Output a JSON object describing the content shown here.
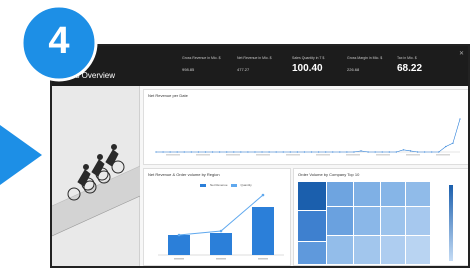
{
  "step_number": "4",
  "header": {
    "title": "Orders Overview",
    "kpis": [
      {
        "label": "Gross Revenue in Mio. $",
        "value": "998.85",
        "big": false
      },
      {
        "label": "Net Revenue in Mio. $",
        "value": "477.27",
        "big": false
      },
      {
        "label": "Sales Quantity in T $",
        "value": "100.40",
        "big": true
      },
      {
        "label": "Gross Margin in Mio. $",
        "value": "226.68",
        "big": false
      },
      {
        "label": "Tax in Mio. $",
        "value": "68.22",
        "big": true
      }
    ]
  },
  "revenue_card": {
    "title": "Net Revenue per Date"
  },
  "bar_card": {
    "title": "Net Revenue & Order volume by Region",
    "legend": [
      "Net Revenue",
      "Quantity"
    ]
  },
  "map_card": {
    "title": "Order Volume by Company Top 10"
  },
  "chart_data": [
    {
      "type": "line",
      "title": "Net Revenue per Date",
      "values": [
        0,
        0,
        0,
        0,
        0,
        0,
        0,
        0,
        0,
        0,
        0,
        0,
        0,
        0,
        0,
        0,
        0,
        0,
        0,
        0,
        0,
        0,
        0,
        0,
        0,
        0,
        0,
        0,
        0,
        1,
        0,
        0,
        0,
        0,
        0,
        2,
        1,
        0,
        0,
        0,
        0,
        5,
        8,
        30
      ],
      "ylim": [
        0,
        40
      ]
    },
    {
      "type": "bar",
      "title": "Net Revenue & Order volume by Region",
      "categories": [
        "EMEA",
        "APJ",
        "AMER"
      ],
      "series": [
        {
          "name": "Net Revenue",
          "values": [
            100,
            110,
            240
          ]
        },
        {
          "name": "Quantity",
          "values": [
            100,
            120,
            300
          ]
        }
      ],
      "ylim": [
        0,
        320
      ]
    },
    {
      "type": "heatmap",
      "title": "Order Volume by Company Top 10",
      "color_range": [
        "#c5dcf5",
        "#1b5fad"
      ]
    }
  ]
}
